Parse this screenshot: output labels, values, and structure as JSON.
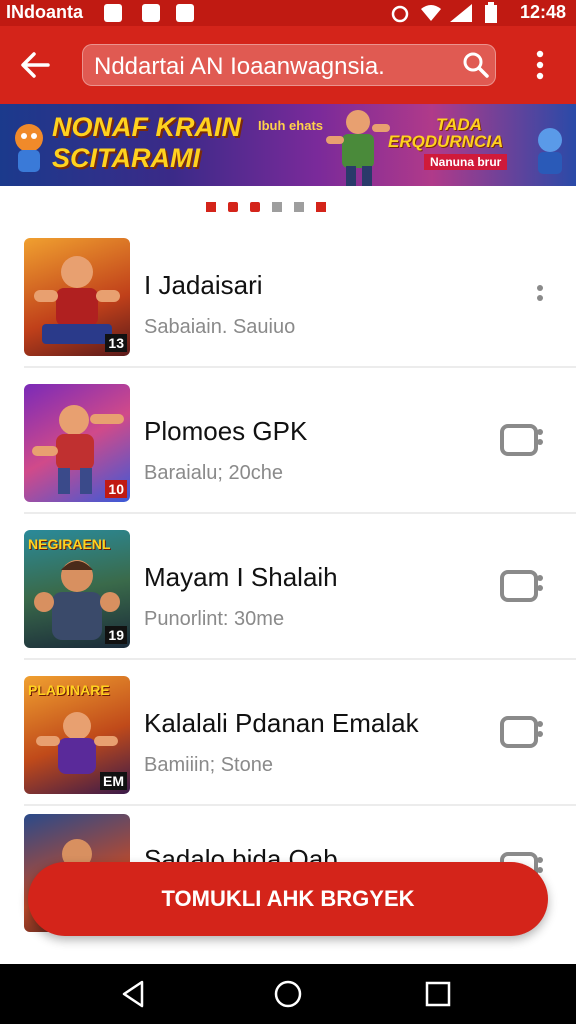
{
  "status_bar": {
    "carrier": "INdoanta",
    "time": "12:48",
    "icons": [
      "notification-icon",
      "photo-icon",
      "download-icon",
      "alarm-icon",
      "wifi-icon",
      "signal-icon",
      "battery-icon"
    ]
  },
  "app_bar": {
    "search_value": "Nddartai AN Ioaanwagnsia.",
    "icons": [
      "back-arrow-icon",
      "search-icon",
      "more-vert-icon"
    ]
  },
  "banner": {
    "left_text_line1": "NONAF KRAIN",
    "left_text_line2": "SCITARAMI",
    "mid_text": "Ibuh ehats",
    "right_text_line1": "TADA",
    "right_text_line2": "ERQDURNCIA",
    "right_tag": "Nanuna brur"
  },
  "carousel": {
    "total": 6,
    "active_index": 2,
    "active_color": "#d4241a",
    "inactive_color": "#9e9e9e"
  },
  "list": [
    {
      "title": "I Jadaisari",
      "subtitle": "Sabaiain. Sauiuo",
      "badge": "13",
      "thumb_label": "",
      "action": "more-vert-icon"
    },
    {
      "title": "Plomoes GPK",
      "subtitle": "Baraialu; 20che",
      "badge": "10",
      "thumb_label": "",
      "action": "install-icon"
    },
    {
      "title": "Mayam I Shalaih",
      "subtitle": "Punorlint: 30me",
      "badge": "19",
      "thumb_label": "NEGIRAENL",
      "action": "install-icon"
    },
    {
      "title": "Kalalali Pdanan Emalak",
      "subtitle": "Bamiiin; Stone",
      "badge": "EM",
      "thumb_label": "PLADINARE",
      "action": "install-icon"
    },
    {
      "title": "Sadalo bida Qab",
      "subtitle": "",
      "badge": "",
      "thumb_label": "",
      "action": "install-icon"
    }
  ],
  "cta": {
    "label": "TOMUKLI AHK BRGYEK"
  },
  "colors": {
    "brand": "#d4241a",
    "status_bar": "#c01a12"
  }
}
